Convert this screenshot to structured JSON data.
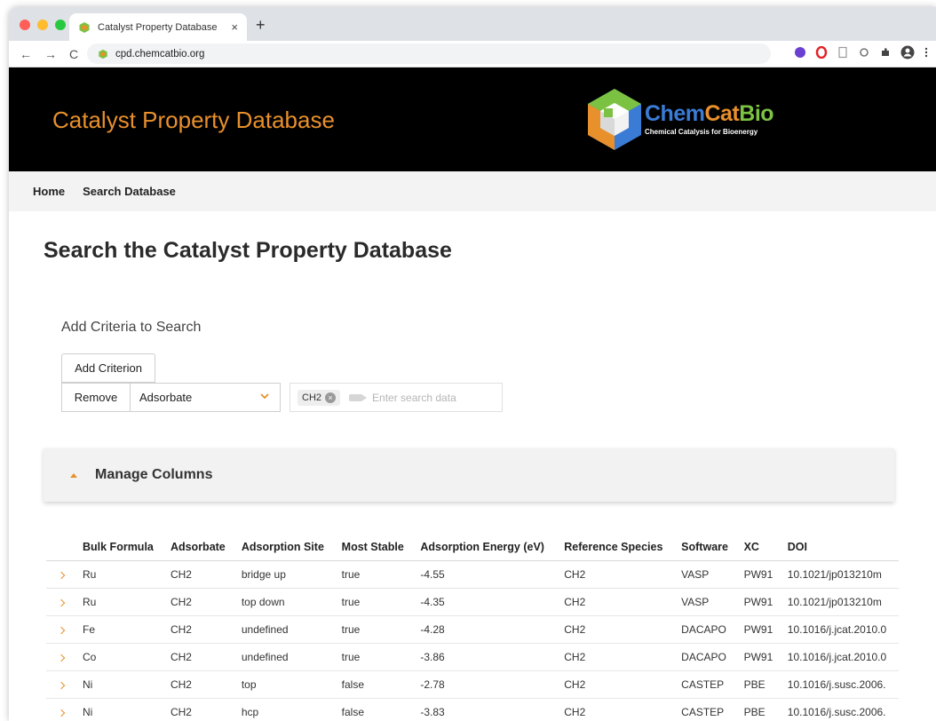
{
  "browser": {
    "tab_title": "Catalyst Property Database",
    "tab_close": "×",
    "new_tab": "+",
    "url": "cpd.chemcatbio.org",
    "nav": {
      "back": "←",
      "forward": "→",
      "reload": "C"
    }
  },
  "site": {
    "title": "Catalyst Property Database",
    "logo": {
      "chem": "Chem",
      "cat": "Cat",
      "bio": "Bio",
      "tagline": "Chemical Catalysis for Bioenergy"
    },
    "nav": [
      {
        "label": "Home"
      },
      {
        "label": "Search Database"
      }
    ]
  },
  "page": {
    "title": "Search the Catalyst Property Database",
    "criteria_heading": "Add Criteria to Search",
    "add_criterion_label": "Add Criterion",
    "remove_label": "Remove",
    "criterion_selected": "Adsorbate",
    "chip_value": "CH2",
    "chip_remove": "×",
    "search_placeholder": "Enter search data",
    "manage_columns_label": "Manage Columns"
  },
  "table": {
    "headers": [
      "Bulk Formula",
      "Adsorbate",
      "Adsorption Site",
      "Most Stable",
      "Adsorption Energy (eV)",
      "Reference Species",
      "Software",
      "XC",
      "DOI"
    ],
    "rows": [
      [
        "Ru",
        "CH2",
        "bridge up",
        "true",
        "-4.55",
        "CH2",
        "VASP",
        "PW91",
        "10.1021/jp013210m"
      ],
      [
        "Ru",
        "CH2",
        "top down",
        "true",
        "-4.35",
        "CH2",
        "VASP",
        "PW91",
        "10.1021/jp013210m"
      ],
      [
        "Fe",
        "CH2",
        "undefined",
        "true",
        "-4.28",
        "CH2",
        "DACAPO",
        "PW91",
        "10.1016/j.jcat.2010.0"
      ],
      [
        "Co",
        "CH2",
        "undefined",
        "true",
        "-3.86",
        "CH2",
        "DACAPO",
        "PW91",
        "10.1016/j.jcat.2010.0"
      ],
      [
        "Ni",
        "CH2",
        "top",
        "false",
        "-2.78",
        "CH2",
        "CASTEP",
        "PBE",
        "10.1016/j.susc.2006."
      ],
      [
        "Ni",
        "CH2",
        "hcp",
        "false",
        "-3.83",
        "CH2",
        "CASTEP",
        "PBE",
        "10.1016/j.susc.2006."
      ]
    ]
  },
  "colors": {
    "accent": "#e8902c",
    "header_bg": "#000000",
    "nav_bg": "#f3f3f3"
  }
}
